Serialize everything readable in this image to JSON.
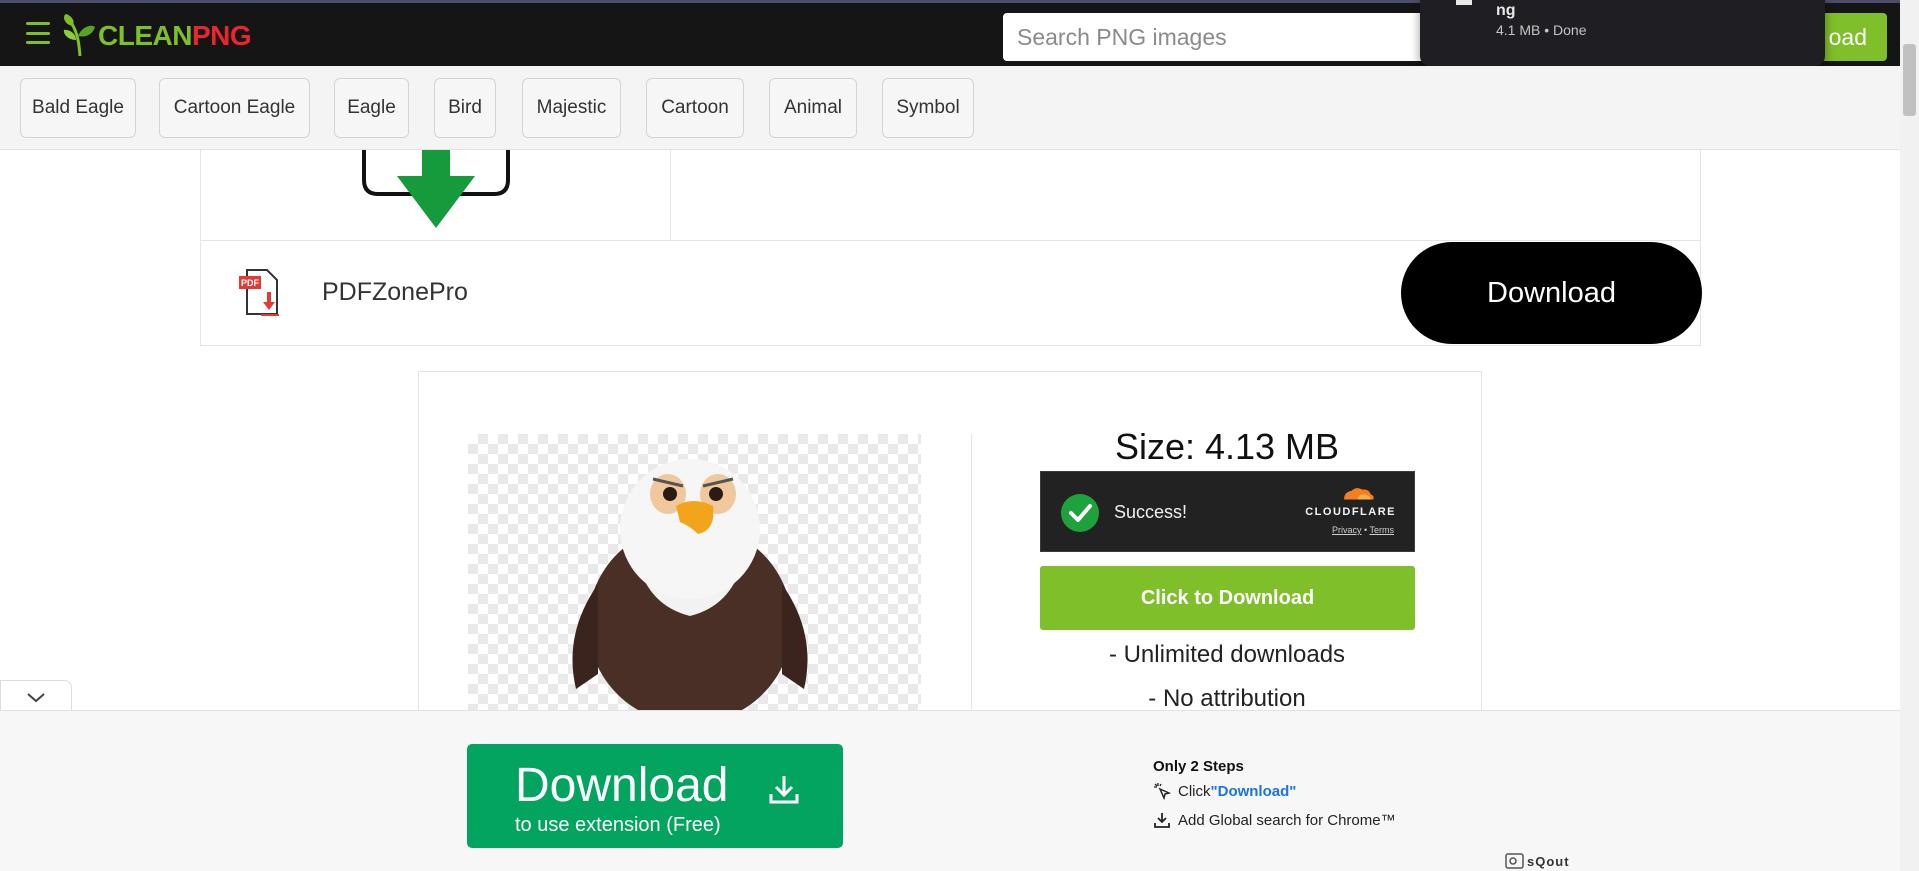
{
  "header": {
    "logo_part1": "CLEAN",
    "logo_part2": "PNG",
    "search_placeholder": "Search PNG images",
    "download_button_label": "oad"
  },
  "download_popup": {
    "file_name": "ng",
    "meta": "4.1 MB • Done"
  },
  "tags": [
    "Bald Eagle",
    "Cartoon Eagle",
    "Eagle",
    "Bird",
    "Majestic",
    "Cartoon",
    "Animal",
    "Symbol"
  ],
  "ad": {
    "pdf_badge": "PDF",
    "brand_name": "PDFZonePro",
    "download_label": "Download"
  },
  "card": {
    "size_label": "Size: 4.13 MB",
    "captcha": {
      "status": "Success!",
      "provider": "CLOUDFLARE",
      "privacy_link": "Privacy",
      "separator": "•",
      "terms_link": "Terms"
    },
    "click_to_download": "Click to Download",
    "benefits": [
      "- Unlimited downloads",
      "- No attribution"
    ]
  },
  "bottom_banner": {
    "button_title": "Download",
    "button_subtitle": "to use extension (Free)",
    "steps_title": "Only 2 Steps",
    "step1_prefix": "Click ",
    "step1_highlight": "\"Download\"",
    "step2": "Add Global search for Chrome™",
    "sponsor": "sQout"
  },
  "colors": {
    "brand_green": "#7fbf2a",
    "brand_red": "#e8262d",
    "extension_green": "#03a45f",
    "link_blue": "#1a73e8"
  }
}
